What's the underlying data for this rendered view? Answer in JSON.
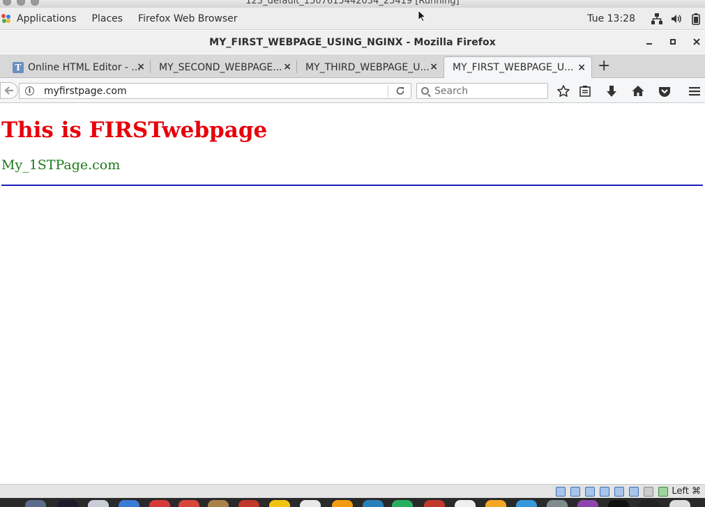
{
  "host_window": {
    "title": "123_default_1507615442034_25419 [Running]"
  },
  "gnome_panel": {
    "applications": "Applications",
    "places": "Places",
    "active_app": "Firefox Web Browser",
    "clock": "Tue 13:28"
  },
  "firefox": {
    "window_title": "MY_FIRST_WEBPAGE_USING_NGINX - Mozilla Firefox",
    "tabs": [
      {
        "label": "Online HTML Editor - ...",
        "favicon": "T"
      },
      {
        "label": "MY_SECOND_WEBPAGE..."
      },
      {
        "label": "MY_THIRD_WEBPAGE_U..."
      },
      {
        "label": "MY_FIRST_WEBPAGE_U...",
        "active": true
      }
    ],
    "tab_close": "×",
    "new_tab": "+",
    "url": "myfirstpage.com",
    "search_placeholder": "Search"
  },
  "page": {
    "heading": "This is FIRSTwebpage",
    "subheading": "My_1STPage.com",
    "heading_color": "#e8000b",
    "subheading_color": "#1b7a1b",
    "rule_color": "#1c1cb8"
  },
  "vbox_status": {
    "host_key": "Left ⌘"
  }
}
